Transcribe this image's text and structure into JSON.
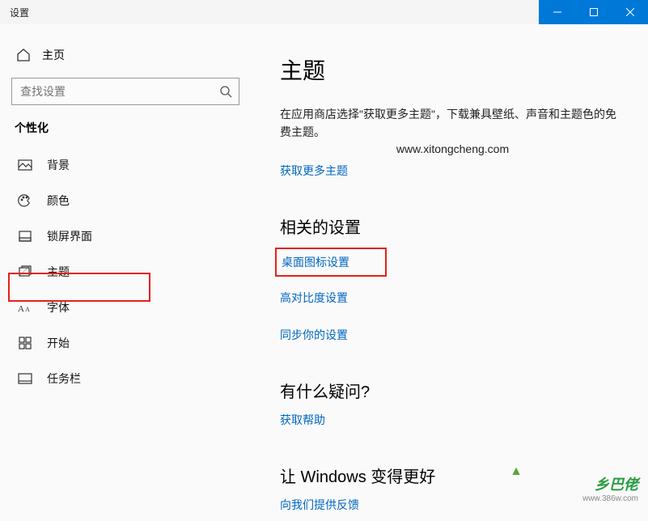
{
  "window": {
    "title": "设置"
  },
  "sidebar": {
    "home_label": "主页",
    "search_placeholder": "查找设置",
    "section_title": "个性化",
    "items": [
      {
        "label": "背景"
      },
      {
        "label": "颜色"
      },
      {
        "label": "锁屏界面"
      },
      {
        "label": "主题"
      },
      {
        "label": "字体"
      },
      {
        "label": "开始"
      },
      {
        "label": "任务栏"
      }
    ]
  },
  "main": {
    "title": "主题",
    "description": "在应用商店选择\"获取更多主题\"，下载兼具壁纸、声音和主题色的免费主题。",
    "watermark_url": "www.xitongcheng.com",
    "store_link": "获取更多主题",
    "related": {
      "heading": "相关的设置",
      "links": [
        "桌面图标设置",
        "高对比度设置",
        "同步你的设置"
      ]
    },
    "help": {
      "heading": "有什么疑问?",
      "link": "获取帮助"
    },
    "feedback": {
      "heading": "让 Windows 变得更好",
      "link": "向我们提供反馈"
    }
  },
  "watermark": {
    "brand": "乡巴佬",
    "site": "www.386w.com"
  }
}
